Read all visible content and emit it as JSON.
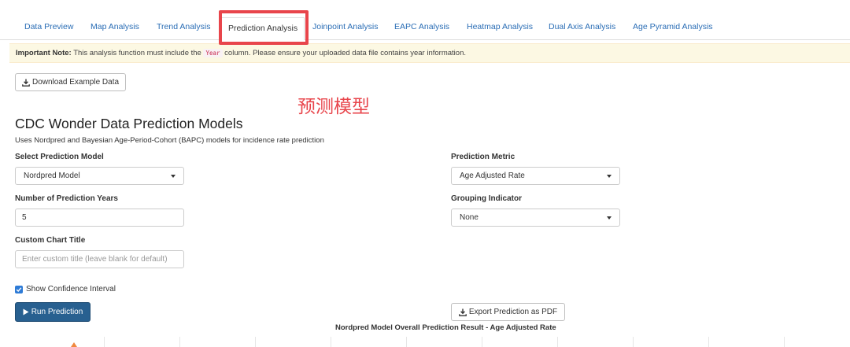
{
  "tabs": [
    {
      "label": "Data Preview"
    },
    {
      "label": "Map Analysis"
    },
    {
      "label": "Trend Analysis"
    },
    {
      "label": "Prediction Analysis"
    },
    {
      "label": "Joinpoint Analysis"
    },
    {
      "label": "EAPC Analysis"
    },
    {
      "label": "Heatmap Analysis"
    },
    {
      "label": "Dual Axis Analysis"
    },
    {
      "label": "Age Pyramid Analysis"
    }
  ],
  "note": {
    "strong": "Important Note:",
    "before": "This analysis function must include the",
    "code": "Year",
    "after": "column. Please ensure your uploaded data file contains year information."
  },
  "download_label": "Download Example Data",
  "annotation": "预测模型",
  "title": "CDC Wonder Data Prediction Models",
  "subtitle": "Uses Nordpred and Bayesian Age-Period-Cohort (BAPC) models for incidence rate prediction",
  "form": {
    "model_label": "Select Prediction Model",
    "model_value": "Nordpred Model",
    "years_label": "Number of Prediction Years",
    "years_value": "5",
    "custom_title_label": "Custom Chart Title",
    "custom_title_placeholder": "Enter custom title (leave blank for default)",
    "metric_label": "Prediction Metric",
    "metric_value": "Age Adjusted Rate",
    "group_label": "Grouping Indicator",
    "group_value": "None",
    "ci_label": "Show Confidence Interval",
    "ci_checked": true
  },
  "run_label": "Run Prediction",
  "export_label": "Export Prediction as PDF",
  "chart_title": "Nordpred Model Overall Prediction Result - Age Adjusted Rate",
  "colors": {
    "highlight": "#e8454b",
    "link": "#2a6db5",
    "primary": "#286090",
    "note_bg": "#fcf8e3",
    "checkbox": "#2e7bd6"
  }
}
